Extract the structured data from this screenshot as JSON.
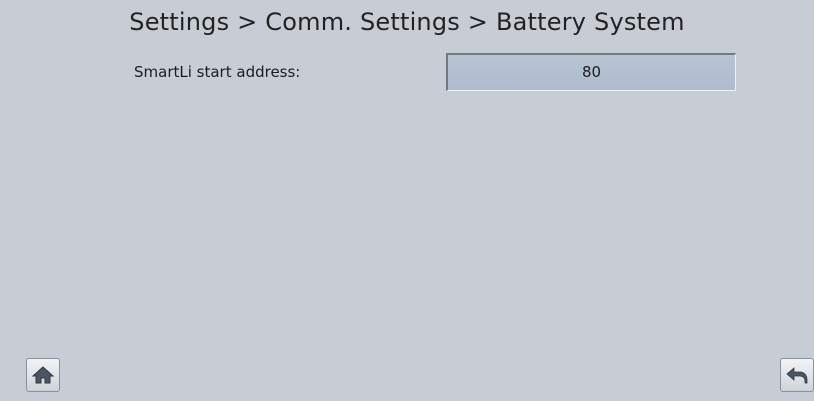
{
  "header": {
    "breadcrumb_title": "Settings > Comm. Settings > Battery System"
  },
  "settings": {
    "smartli_start_address": {
      "label": "SmartLi start address:",
      "value": "80"
    }
  },
  "navigation": {
    "home_icon": "home-icon",
    "back_icon": "back-arrow-icon"
  },
  "colors": {
    "background": "#c8cdd5",
    "value_field": "#b2bfcf"
  }
}
